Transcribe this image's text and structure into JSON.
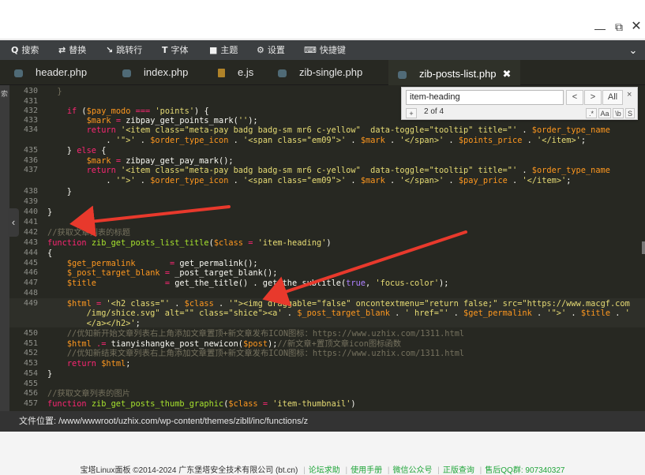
{
  "window": {
    "minimize_icon": "minimize-icon",
    "maximize_icon": "maximize-icon",
    "close_icon": "close-icon"
  },
  "toolbar": {
    "items": [
      {
        "icon": "search-icon",
        "glyph": "Q",
        "label": "搜索"
      },
      {
        "icon": "replace-icon",
        "glyph": "⇄",
        "label": "替换"
      },
      {
        "icon": "goto-line-icon",
        "glyph": "↘",
        "label": "跳转行"
      },
      {
        "icon": "font-icon",
        "glyph": "T",
        "label": "字体"
      },
      {
        "icon": "theme-icon",
        "glyph": "■",
        "label": "主题"
      },
      {
        "icon": "settings-icon",
        "glyph": "⚙",
        "label": "设置"
      },
      {
        "icon": "shortcut-icon",
        "glyph": "⌨",
        "label": "快捷键"
      }
    ],
    "collapse_icon": "chevron-down-icon"
  },
  "tabs": [
    {
      "label": "header.php",
      "icon": "php-file-icon"
    },
    {
      "label": "index.php",
      "icon": "php-file-icon"
    },
    {
      "label": "e.js",
      "icon": "js-file-icon"
    },
    {
      "label": "zib-single.php",
      "icon": "php-file-icon"
    },
    {
      "label": "zib-posts-list.php",
      "icon": "php-file-icon",
      "active": true
    }
  ],
  "left_strip_label": "索",
  "find": {
    "value": "item-heading",
    "count": "2 of 4",
    "prev": "<",
    "next": ">",
    "all": "All",
    "close": "×",
    "add": "+",
    "regex": ".*",
    "case": "Aa",
    "word": "\\b",
    "selection": "S"
  },
  "code": {
    "line_numbers": [
      "430",
      "431",
      "432",
      "433",
      "434",
      "",
      "435",
      "436",
      "437",
      "",
      "438",
      "439",
      "440",
      "441",
      "442",
      "443",
      "444",
      "445",
      "446",
      "447",
      "448",
      "449",
      "",
      "",
      "450",
      "451",
      "452",
      "453",
      "454",
      "455",
      "456",
      "457"
    ]
  },
  "statusbar": {
    "label": "文件位置:",
    "path": "/www/wwwroot/uzhix.com/wp-content/themes/zibll/inc/functions/z"
  },
  "footer": {
    "copyright": "宝塔Linux面板 ©2014-2024 广东堡塔安全技术有限公司 (bt.cn)",
    "links": [
      "论坛求助",
      "使用手册",
      "微信公众号",
      "正版查询"
    ],
    "qq": "售后QQ群: 907340327"
  },
  "colors": {
    "editor_bg": "#272822",
    "toolbar_bg": "#3c3f41",
    "arrow": "#e8392c",
    "accent_green": "#20a53a"
  }
}
